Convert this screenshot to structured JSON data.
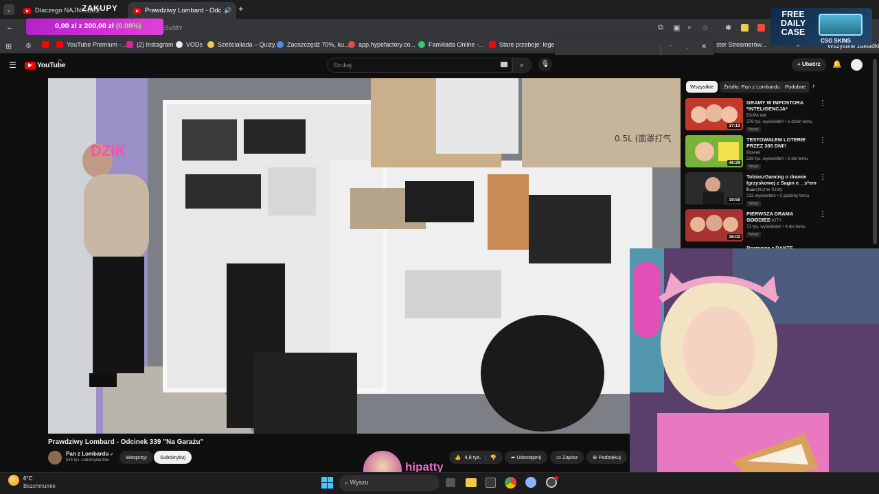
{
  "browser": {
    "tabs": [
      {
        "label": "Dlaczego NAJNIEBEZ",
        "active": false
      },
      {
        "label": "Prawdziwy Lombard - Odc",
        "active": true
      }
    ],
    "address_fragment": "c5x88Y",
    "bookmarks": [
      {
        "label": "YouTube Premium -...",
        "color": "#ff0000"
      },
      {
        "label": "(2) Instagram",
        "color": "#d6249f"
      },
      {
        "label": "VODs",
        "color": "#e8eaed"
      },
      {
        "label": "Sześcialiada – Quizy...",
        "color": "#f2c94c"
      },
      {
        "label": "Zaoszczędź 70%, ku...",
        "color": "#4a90e2"
      },
      {
        "label": "app.hypefactory.co...",
        "color": "#e74c3c"
      },
      {
        "label": "Familiada Online -...",
        "color": "#2ecc71"
      },
      {
        "label": "Stare przeboje: lege...",
        "color": "#ff0000"
      },
      {
        "label": "ster Streamerów...",
        "color": ""
      },
      {
        "label": "Wszystkie zakładki",
        "color": ""
      }
    ]
  },
  "overlay": {
    "zakupy_title": "ZAKUPY",
    "zakupy_current": "0,00 zł",
    "zakupy_sep": " z ",
    "zakupy_goal": "200,00 zł",
    "zakupy_percent": "(0.00%)",
    "promo_free": "FREE DAILY CASE",
    "promo_brand": "CSG SKINS",
    "streamer_name": "hipatty"
  },
  "youtube": {
    "logo": "YouTube",
    "region": "PL",
    "search_placeholder": "Szukaj",
    "create_label": "Utwórz",
    "video_title": "Prawdziwy Lombard - Odcinek 339 \"Na Garażu\"",
    "channel_name": "Pan z Lombardu",
    "subscribers": "544 tys. subskrybentów",
    "support_label": "Wesprzyj",
    "subscribe_label": "Subskrybuj",
    "likes": "4,8 tys.",
    "share_label": "Udostępnij",
    "save_label": "Zapisz",
    "thanks_label": "Podziękuj",
    "video_overlay_text": "0.5L (面罩打气",
    "neon_sign": "DZIK",
    "chips": [
      "Wszystkie",
      "Źródło: Pan z Lombardu",
      "Podobne"
    ],
    "related": [
      {
        "title": "GRAMY W IMPOSTORA *INTELIGENCJA*",
        "channel": "EKIPA WK",
        "meta": "376 tys. wyświetleń • 1 dzień temu",
        "badge": "Nowy",
        "duration": "37:13",
        "thumb": "#c0392b"
      },
      {
        "title": "TESTOWAŁEM LOTERIE PRZEZ 365 DNI!!",
        "channel": "Blowek",
        "meta": "239 tys. wyświetleń • 2 dni temu",
        "badge": "Nowy",
        "duration": "46:29",
        "thumb": "#b8a12c"
      },
      {
        "title": "TobiaszGaming o dramie Igrzyskowej z Sagin e__s*em i ...",
        "channel": "Anarchiczne Szoty",
        "meta": "212 wyświetleń • 2 godziny temu",
        "badge": "Nowy",
        "duration": "19:50",
        "thumb": "#3a3a3a"
      },
      {
        "title": "PIERWSZA DRAMA GOODIEZ",
        "channel": "SERHITO SHOTY",
        "meta": "71 tys. wyświetleń • 4 dni temu",
        "badge": "Nowy",
        "duration": "36:02",
        "thumb": "#a83232"
      }
    ],
    "related_partial": "Rozmowa z DANTE PARTYMEY"
  },
  "taskbar": {
    "weather_temp": "6°C",
    "weather_desc": "Bezchmurnie",
    "search_placeholder": "Wyszu"
  }
}
